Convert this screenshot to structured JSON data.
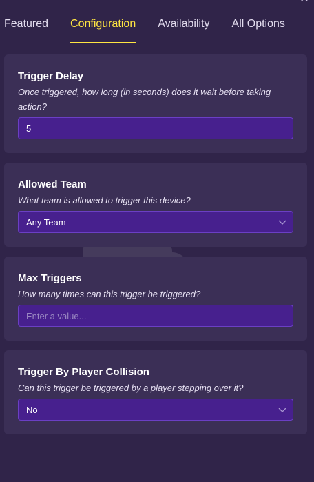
{
  "close_glyph": "✕",
  "tabs": [
    {
      "label": "Featured",
      "active": false
    },
    {
      "label": "Configuration",
      "active": true
    },
    {
      "label": "Availability",
      "active": false
    },
    {
      "label": "All Options",
      "active": false
    }
  ],
  "sections": {
    "trigger_delay": {
      "title": "Trigger Delay",
      "description": "Once triggered, how long (in seconds) does it wait before taking action?",
      "value": "5"
    },
    "allowed_team": {
      "title": "Allowed Team",
      "description": "What team is allowed to trigger this device?",
      "selected": "Any Team"
    },
    "max_triggers": {
      "title": "Max Triggers",
      "description": "How many times can this trigger be triggered?",
      "value": "",
      "placeholder": "Enter a value..."
    },
    "player_collision": {
      "title": "Trigger By Player Collision",
      "description": "Can this trigger be triggered by a player stepping over it?",
      "selected": "No"
    }
  },
  "colors": {
    "background": "#302449",
    "card": "#3b2f56",
    "field": "#47208e",
    "field_border": "#6b3fc4",
    "active_tab": "#ffe642",
    "tab_divider": "#4e3b84"
  },
  "icons": {
    "close": "close-icon",
    "dropdown": "chevron-down-icon",
    "background_art": "trigger-device-icon"
  }
}
